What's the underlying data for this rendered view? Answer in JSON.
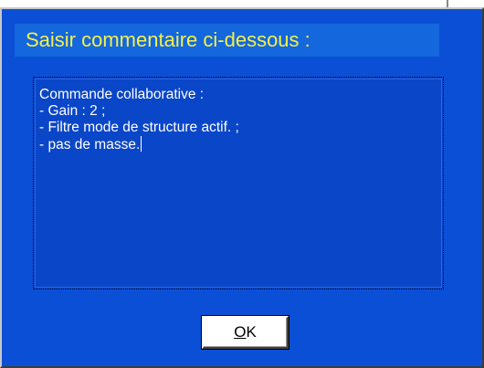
{
  "dialog": {
    "title": "Saisir commentaire ci-dessous :",
    "comment_lines": [
      "Commande collaborative :",
      "- Gain : 2 ;",
      "- Filtre mode de structure actif. ;",
      "- pas de masse."
    ],
    "ok_button": {
      "mnemonic": "O",
      "rest": "K"
    }
  },
  "colors": {
    "dialog_bg": "#0b4fd6",
    "title_band": "#1467dc",
    "title_text": "#f4f04a",
    "text_area_bg": "#0a46c8",
    "text_color": "#ffffff"
  }
}
